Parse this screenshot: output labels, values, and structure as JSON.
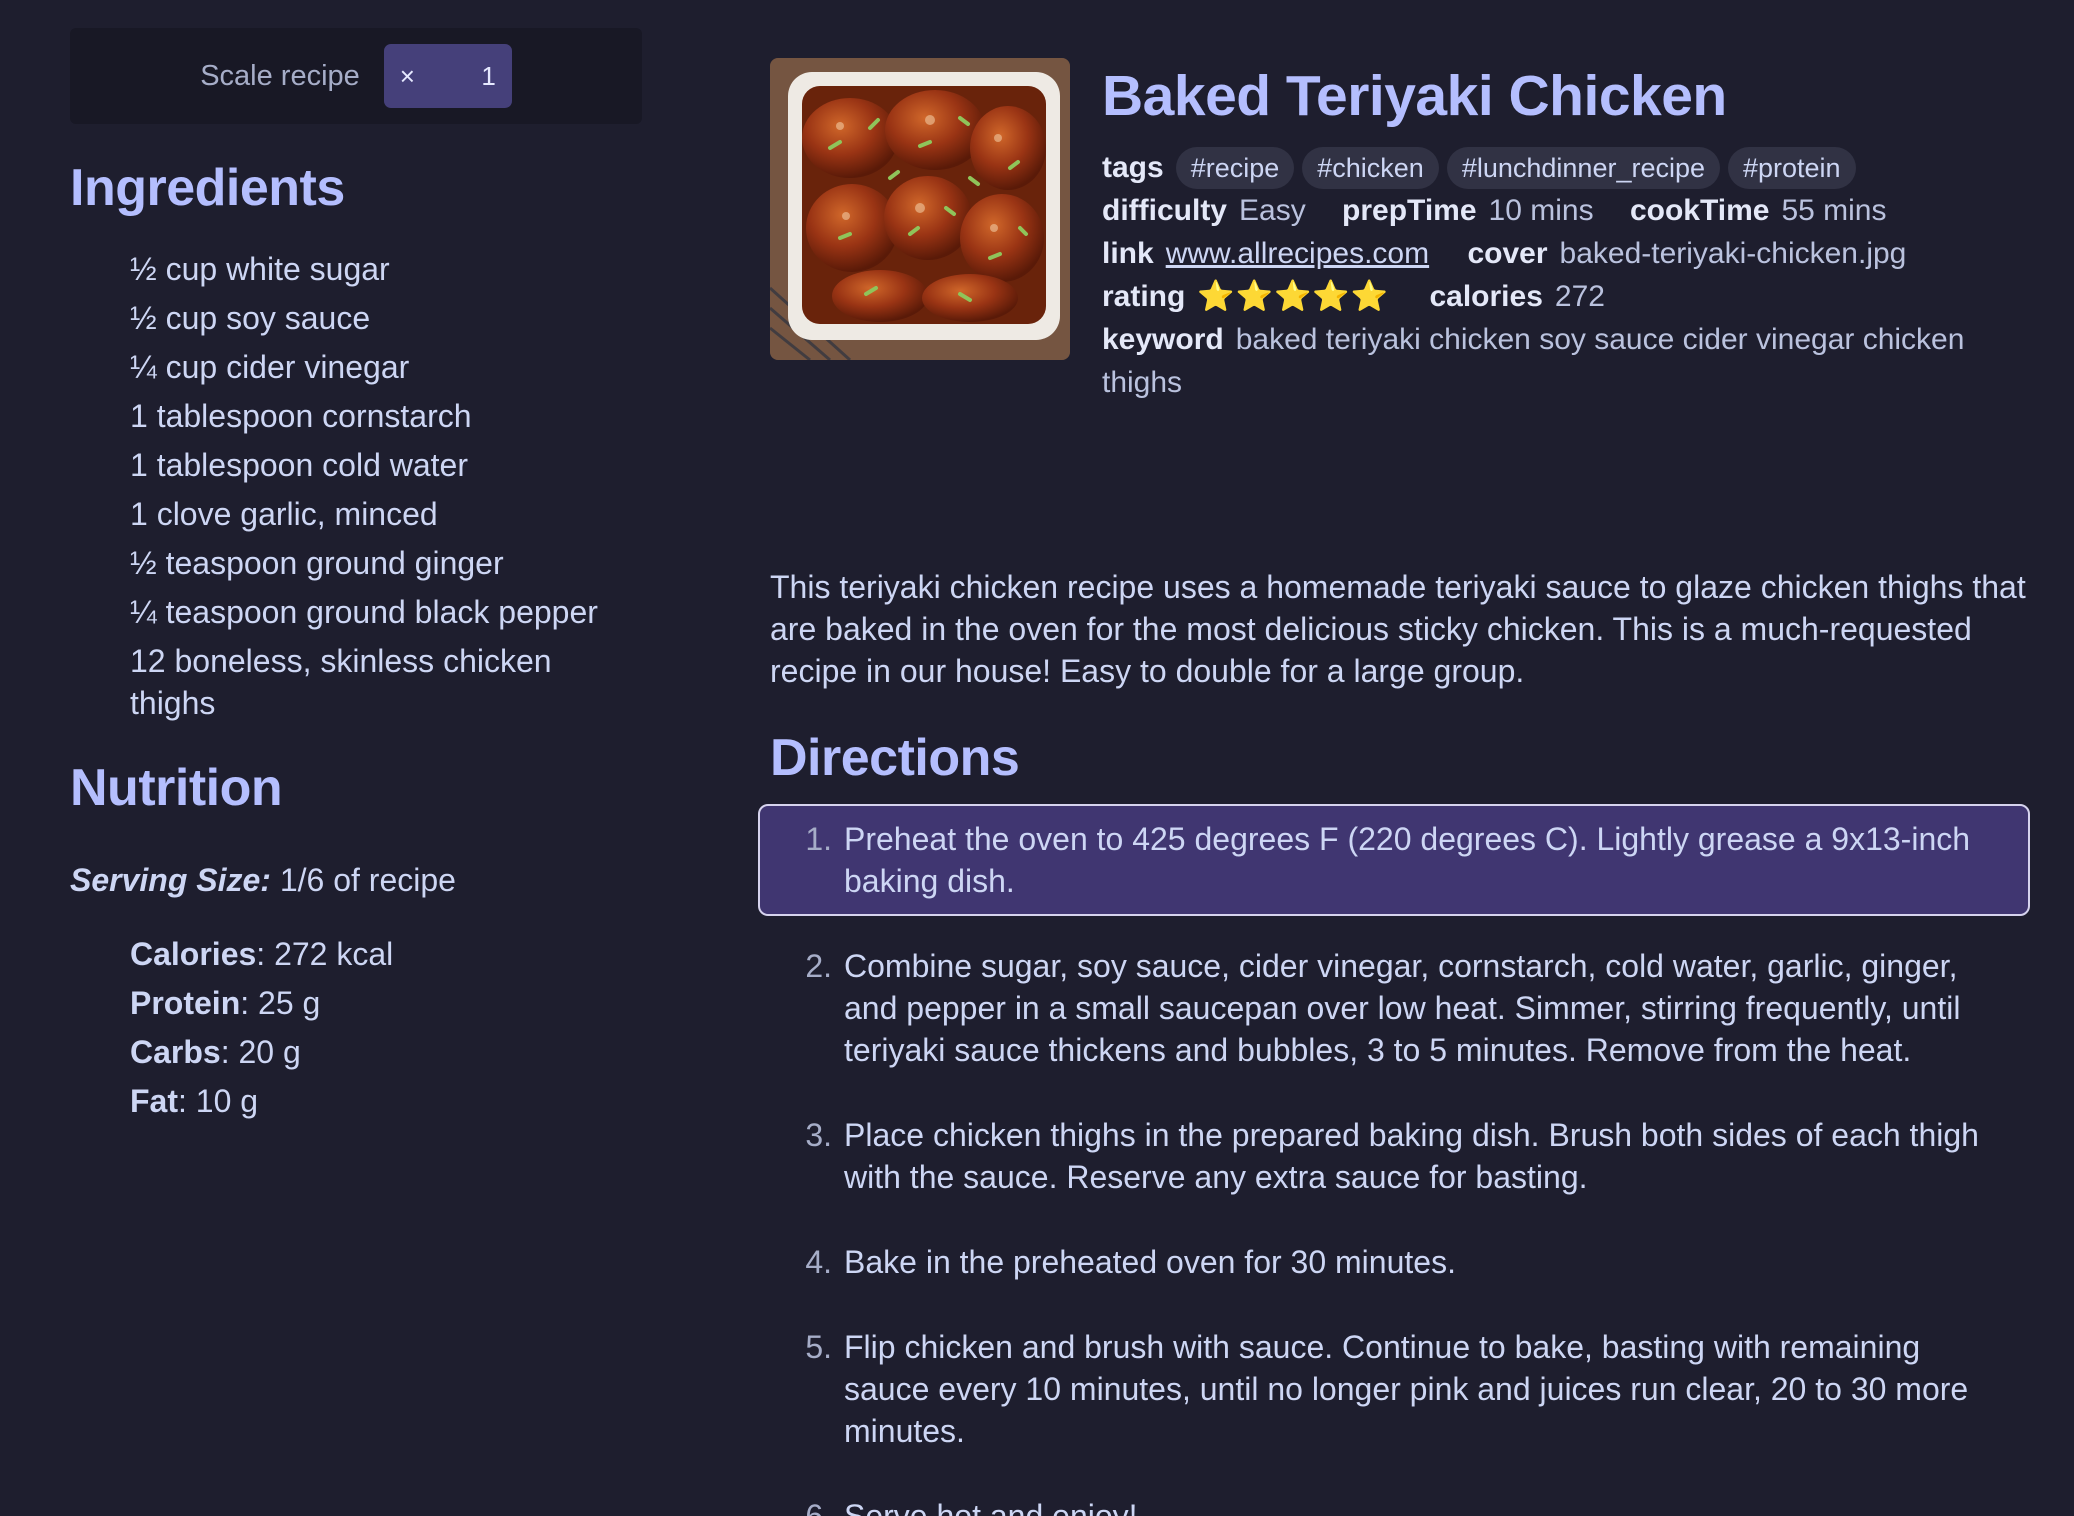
{
  "scale": {
    "label": "Scale recipe",
    "multiplier_symbol": "×",
    "value": "1"
  },
  "ingredients": {
    "title": "Ingredients",
    "items": [
      "½ cup white sugar",
      "½ cup soy sauce",
      "¼ cup cider vinegar",
      "1 tablespoon cornstarch",
      "1 tablespoon cold water",
      "1 clove garlic, minced",
      "½ teaspoon ground ginger",
      "¼ teaspoon ground black pepper",
      "12 boneless, skinless chicken thighs"
    ]
  },
  "nutrition": {
    "title": "Nutrition",
    "serving_label": "Serving Size:",
    "serving_value": "1/6 of recipe",
    "items": [
      {
        "label": "Calories",
        "value": ": 272 kcal"
      },
      {
        "label": "Protein",
        "value": ": 25 g"
      },
      {
        "label": "Carbs",
        "value": ": 20 g"
      },
      {
        "label": "Fat",
        "value": ": 10 g"
      }
    ]
  },
  "recipe": {
    "title": "Baked Teriyaki Chicken",
    "tags_label": "tags",
    "tags": [
      "#recipe",
      "#chicken",
      "#lunchdinner_recipe",
      "#protein"
    ],
    "difficulty_label": "difficulty",
    "difficulty": "Easy",
    "preptime_label": "prepTime",
    "preptime": "10 mins",
    "cooktime_label": "cookTime",
    "cooktime": "55 mins",
    "link_label": "link",
    "link": "www.allrecipes.com",
    "cover_label": "cover",
    "cover": "baked-teriyaki-chicken.jpg",
    "rating_label": "rating",
    "rating_stars": "⭐⭐⭐⭐⭐",
    "calories_label": "calories",
    "calories": "272",
    "keyword_label": "keyword",
    "keyword": "baked teriyaki chicken soy sauce cider vinegar chicken thighs",
    "description": "This teriyaki chicken recipe uses a homemade teriyaki sauce to glaze chicken thighs that are baked in the oven for the most delicious sticky chicken. This is a much-requested recipe in our house! Easy to double for a large group."
  },
  "directions": {
    "title": "Directions",
    "active_index": 0,
    "steps": [
      "Preheat the oven to 425 degrees F (220 degrees C). Lightly grease a 9x13-inch baking dish.",
      "Combine sugar, soy sauce, cider vinegar, cornstarch, cold water, garlic, ginger, and pepper in a small saucepan over low heat. Simmer, stirring frequently, until teriyaki sauce thickens and bubbles, 3 to 5 minutes. Remove from the heat.",
      "Place chicken thighs in the prepared baking dish. Brush both sides of each thigh with the sauce. Reserve any extra sauce for basting.",
      "Bake in the preheated oven for 30 minutes.",
      "Flip chicken and brush with sauce. Continue to bake, basting with remaining sauce every 10 minutes, until no longer pink and juices run clear, 20 to 30 more minutes.",
      "Serve hot and enjoy!"
    ]
  },
  "colors": {
    "background": "#1e1e2e",
    "heading": "#b4befe",
    "text": "#cdd6f4",
    "active_step": "#403671",
    "scale_control": "#45407a",
    "tag_bg": "#313244"
  }
}
